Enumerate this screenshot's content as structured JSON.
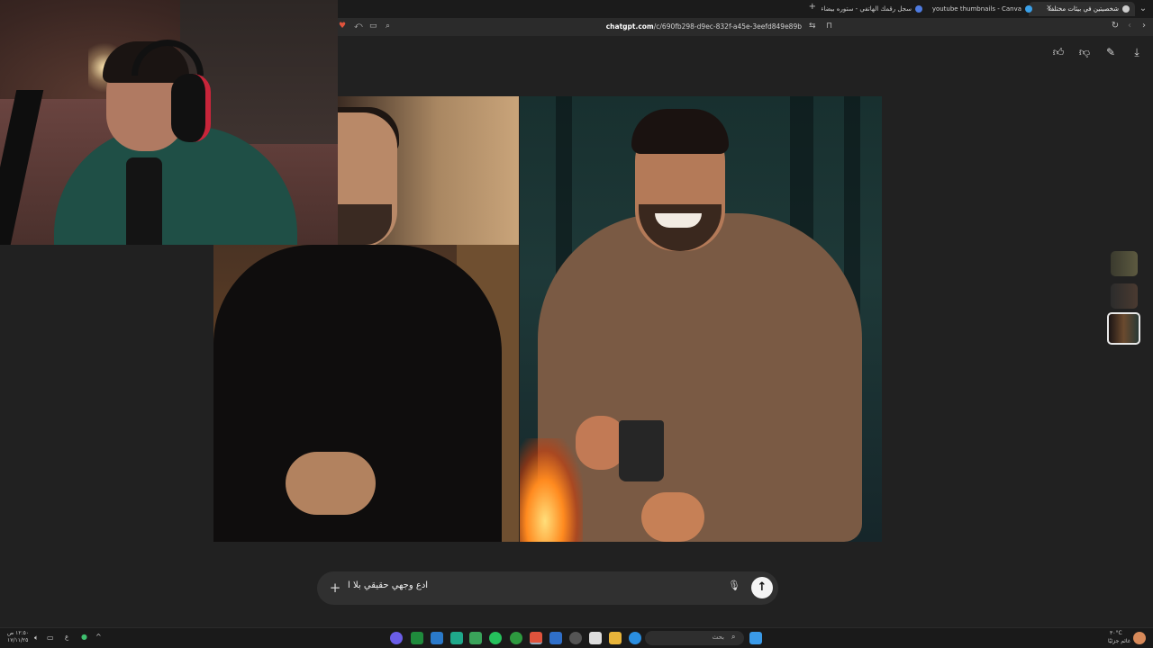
{
  "browser": {
    "tabs": [
      {
        "label": "شخصيتين في بيئات مختلفة",
        "active": true
      },
      {
        "label": "youtube thumbnails - Canva يحث عن",
        "active": false
      },
      {
        "label": "سجل رقمك الهاتفي - ستوره بيضاء",
        "active": false
      }
    ],
    "url_host": "chatgpt.com",
    "url_path": "/c/690fb298-d9ec-832f-a45e-3eefd849e89b"
  },
  "actions": {
    "icons": [
      "thumbs-up-icon",
      "thumbs-down-icon",
      "edit-image-icon",
      "download-icon"
    ]
  },
  "composer": {
    "plus": "+",
    "text": "ادع وجهي حقيقي بلا ا",
    "mic": "🎙",
    "send": "↑"
  },
  "taskbar": {
    "search_placeholder": "بحث",
    "weather_temp": "٣٠°C",
    "weather_desc": "غائم جزئيًا",
    "clock_time": "١٢:٥٠ ص",
    "clock_date": "١٧/١١/٢٥",
    "lang": "ع"
  },
  "colors": {
    "background": "#212121",
    "composer": "#303030",
    "send_button": "#f4f4f4"
  }
}
